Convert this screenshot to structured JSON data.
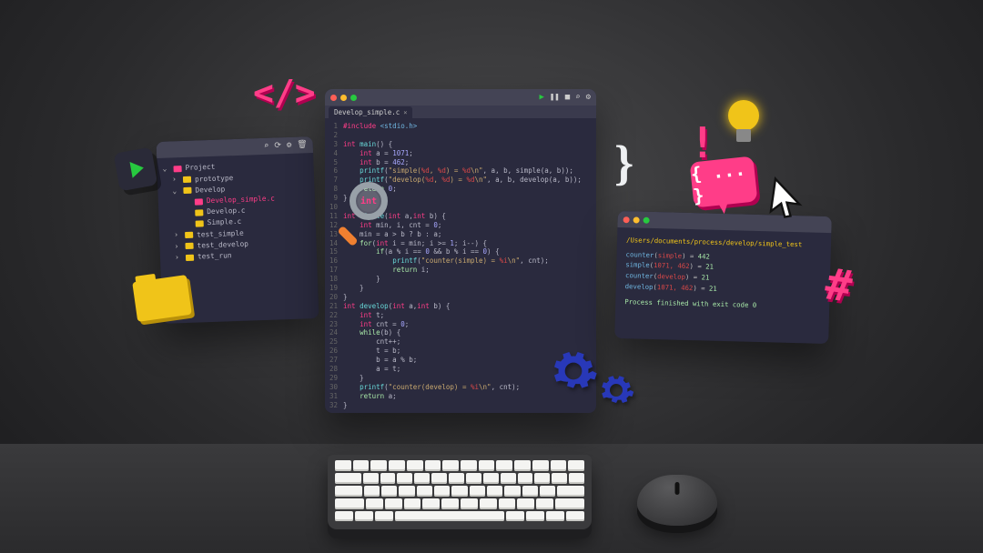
{
  "editor": {
    "tab_label": "Develop_simple.c",
    "toolbar_icons": [
      "play-icon",
      "pause-icon",
      "stop-icon",
      "search-icon",
      "gear-icon"
    ],
    "code_lines": [
      {
        "n": 1,
        "html": "<span class='tok-pre'>#include</span> <span class='tok-inc'>&lt;stdio.h&gt;</span>"
      },
      {
        "n": 2,
        "html": ""
      },
      {
        "n": 3,
        "html": "<span class='tok-type'>int</span> <span class='tok-fn'>main</span>() {"
      },
      {
        "n": 4,
        "html": "    <span class='tok-type'>int</span> a = <span class='tok-num'>1071</span>;"
      },
      {
        "n": 5,
        "html": "    <span class='tok-type'>int</span> b = <span class='tok-num'>462</span>;"
      },
      {
        "n": 6,
        "html": "    <span class='tok-fn'>printf</span>(<span class='tok-str'>\"simple(</span><span class='tok-fmt'>%d</span><span class='tok-str'>, </span><span class='tok-fmt'>%d</span><span class='tok-str'>) = </span><span class='tok-fmt'>%d</span><span class='tok-str'>\\n\"</span>, a, b, simple(a, b));"
      },
      {
        "n": 7,
        "html": "    <span class='tok-fn'>printf</span>(<span class='tok-str'>\"develop(</span><span class='tok-fmt'>%d</span><span class='tok-str'>, </span><span class='tok-fmt'>%d</span><span class='tok-str'>) = </span><span class='tok-fmt'>%d</span><span class='tok-str'>\\n\"</span>, a, b, develop(a, b));"
      },
      {
        "n": 8,
        "html": "    <span class='tok-kw'>return</span> <span class='tok-num'>0</span>;"
      },
      {
        "n": 9,
        "html": "}"
      },
      {
        "n": 10,
        "html": ""
      },
      {
        "n": 11,
        "html": "<span class='tok-type'>int</span> <span class='tok-fn'>simple</span>(<span class='tok-type'>int</span> a,<span class='tok-type'>int</span> b) {"
      },
      {
        "n": 12,
        "html": "    <span class='tok-type'>int</span> min, i, cnt = <span class='tok-num'>0</span>;"
      },
      {
        "n": 13,
        "html": "    min = a &gt; b ? b : a;"
      },
      {
        "n": 14,
        "html": "    <span class='tok-kw'>for</span>(<span class='tok-type'>int</span> i = min; i &gt;= <span class='tok-num'>1</span>; i--) {"
      },
      {
        "n": 15,
        "html": "        <span class='tok-kw'>if</span>(a % i == <span class='tok-num'>0</span> &amp;&amp; b % i == <span class='tok-num'>0</span>) {"
      },
      {
        "n": 16,
        "html": "            <span class='tok-fn'>printf</span>(<span class='tok-str'>\"counter(simple) = </span><span class='tok-fmt'>%i</span><span class='tok-str'>\\n\"</span>, cnt);"
      },
      {
        "n": 17,
        "html": "            <span class='tok-kw'>return</span> i;"
      },
      {
        "n": 18,
        "html": "        }"
      },
      {
        "n": 19,
        "html": "    }"
      },
      {
        "n": 20,
        "html": "}"
      },
      {
        "n": 21,
        "html": "<span class='tok-type'>int</span> <span class='tok-fn'>develop</span>(<span class='tok-type'>int</span> a,<span class='tok-type'>int</span> b) {"
      },
      {
        "n": 22,
        "html": "    <span class='tok-type'>int</span> t;"
      },
      {
        "n": 23,
        "html": "    <span class='tok-type'>int</span> cnt = <span class='tok-num'>0</span>;"
      },
      {
        "n": 24,
        "html": "    <span class='tok-kw'>while</span>(b) {"
      },
      {
        "n": 25,
        "html": "        cnt++;"
      },
      {
        "n": 26,
        "html": "        t = b;"
      },
      {
        "n": 27,
        "html": "        b = a % b;"
      },
      {
        "n": 28,
        "html": "        a = t;"
      },
      {
        "n": 29,
        "html": "    }"
      },
      {
        "n": 30,
        "html": "    <span class='tok-fn'>printf</span>(<span class='tok-str'>\"counter(develop) = </span><span class='tok-fmt'>%i</span><span class='tok-str'>\\n\"</span>, cnt);"
      },
      {
        "n": 31,
        "html": "    <span class='tok-kw'>return</span> a;"
      },
      {
        "n": 32,
        "html": "}"
      }
    ]
  },
  "explorer": {
    "toolbar_icons": [
      "search-icon",
      "refresh-icon",
      "gear-icon",
      "trash-icon"
    ],
    "root": {
      "label": "Project",
      "icon": "folder-pink",
      "expanded": true
    },
    "tree": [
      {
        "depth": 1,
        "label": "prototype",
        "icon": "folder-yellow",
        "expanded": false,
        "chev": "›"
      },
      {
        "depth": 1,
        "label": "Develop",
        "icon": "folder-yellow",
        "expanded": true,
        "chev": "⌄"
      },
      {
        "depth": 2,
        "label": "Develop_simple.c",
        "icon": "file-pink",
        "selected": true
      },
      {
        "depth": 2,
        "label": "Develop.c",
        "icon": "file-yellow"
      },
      {
        "depth": 2,
        "label": "Simple.c",
        "icon": "file-yellow"
      },
      {
        "depth": 1,
        "label": "test_simple",
        "icon": "folder-yellow",
        "expanded": false,
        "chev": "›"
      },
      {
        "depth": 1,
        "label": "test_develop",
        "icon": "folder-yellow",
        "expanded": false,
        "chev": "›"
      },
      {
        "depth": 1,
        "label": "test_run",
        "icon": "folder-yellow",
        "expanded": false,
        "chev": "›"
      }
    ]
  },
  "terminal": {
    "path": "/Users/documents/process/develop/simple_test",
    "lines": [
      {
        "fn": "counter",
        "arg": "simple",
        "val": "442"
      },
      {
        "fn": "simple",
        "arg": "1071, 462",
        "val": "21"
      },
      {
        "fn": "counter",
        "arg": "develop",
        "val": "21"
      },
      {
        "fn": "develop",
        "arg": "1071, 462",
        "val": "21"
      }
    ],
    "exit": "Process finished with exit code 0"
  },
  "magnifier_label": "int",
  "speech_label": "{ ... }"
}
